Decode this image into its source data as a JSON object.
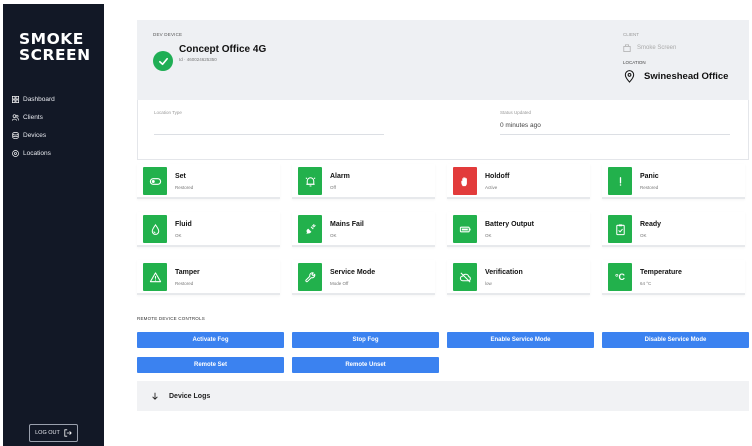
{
  "brand": {
    "line1": "SMOKE",
    "line2": "SCREEN"
  },
  "nav": [
    {
      "label": "Dashboard",
      "icon": "dashboard-icon"
    },
    {
      "label": "Clients",
      "icon": "users-icon"
    },
    {
      "label": "Devices",
      "icon": "devices-icon"
    },
    {
      "label": "Locations",
      "icon": "location-icon"
    }
  ],
  "logout_label": "LOG OUT",
  "device": {
    "section_label": "DEV DEVICE",
    "name": "Concept Office 4G",
    "id_text": "Id · 460024625350",
    "status_color": "#1fae55"
  },
  "client": {
    "label": "CLIENT",
    "name": "Smoke Screen"
  },
  "location": {
    "label": "LOCATION",
    "name": "Swineshead Office"
  },
  "info": {
    "location_type_label": "Location Type",
    "location_type_value": "",
    "status_updated_label": "Status Updated",
    "status_updated_value": "0 minutes ago"
  },
  "tiles": [
    {
      "name": "Set",
      "status": "Restored",
      "color": "green",
      "icon": "toggle-icon"
    },
    {
      "name": "Alarm",
      "status": "Off",
      "color": "green",
      "icon": "alarm-bell-icon"
    },
    {
      "name": "Holdoff",
      "status": "Active",
      "color": "red",
      "icon": "hand-stop-icon"
    },
    {
      "name": "Panic",
      "status": "Restored",
      "color": "green",
      "icon": "exclamation-icon"
    },
    {
      "name": "Fluid",
      "status": "OK",
      "color": "green",
      "icon": "droplet-icon"
    },
    {
      "name": "Mains Fail",
      "status": "OK",
      "color": "green",
      "icon": "plug-icon"
    },
    {
      "name": "Battery Output",
      "status": "OK",
      "color": "green",
      "icon": "battery-icon"
    },
    {
      "name": "Ready",
      "status": "OK",
      "color": "green",
      "icon": "clipboard-check-icon"
    },
    {
      "name": "Tamper",
      "status": "Restored",
      "color": "green",
      "icon": "warning-triangle-icon"
    },
    {
      "name": "Service Mode",
      "status": "Mode Off",
      "color": "green",
      "icon": "wrench-icon"
    },
    {
      "name": "Verification",
      "status": "low",
      "color": "green",
      "icon": "cloud-off-icon"
    },
    {
      "name": "Temperature",
      "status": "64 °C",
      "color": "green",
      "icon": "thermometer-celsius-icon",
      "glyph": "°C"
    }
  ],
  "controls": {
    "section_label": "REMOTE DEVICE CONTROLS",
    "buttons": [
      "Activate Fog",
      "Stop Fog",
      "Enable Service Mode",
      "Disable Service Mode",
      "Remote Set",
      "Remote Unset"
    ]
  },
  "logs": {
    "title": "Device Logs"
  },
  "colors": {
    "sidebar": "#121826",
    "accent": "#3b82f0",
    "ok": "#22b14c",
    "alert": "#e23b3b"
  }
}
